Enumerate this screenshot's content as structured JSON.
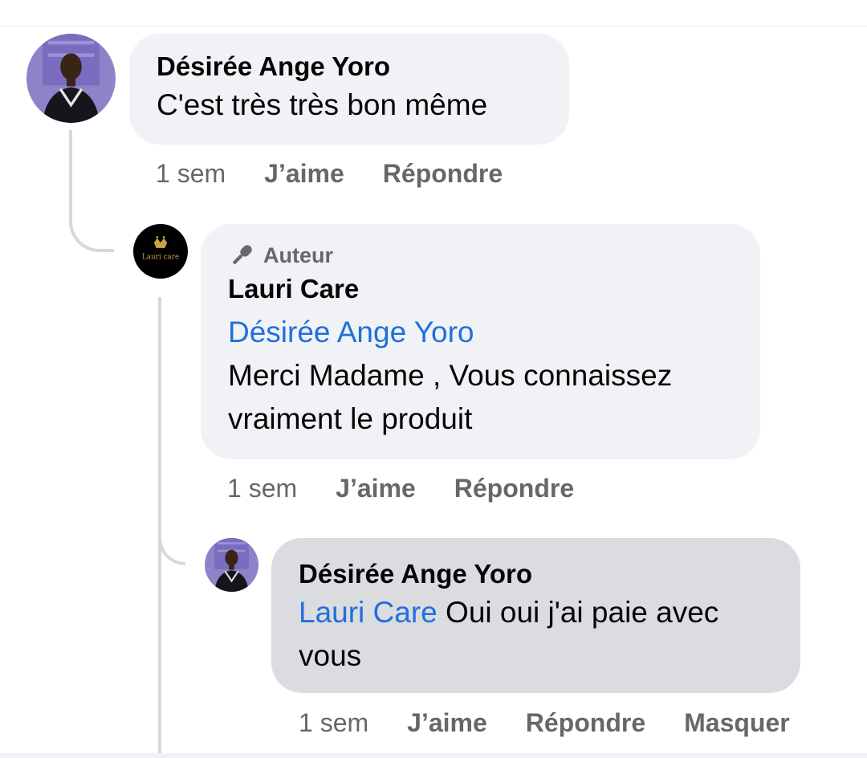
{
  "comments": [
    {
      "author": "Désirée Ange Yoro",
      "text": "C'est très très bon même",
      "time": "1 sem",
      "actions": [
        "J’aime",
        "Répondre"
      ]
    },
    {
      "badge": "Auteur",
      "badge_icon": "microphone-icon",
      "author": "Lauri Care",
      "mention": "Désirée Ange Yoro",
      "text": "Merci Madame , Vous connaissez vraiment le produit",
      "time": "1 sem",
      "actions": [
        "J’aime",
        "Répondre"
      ]
    },
    {
      "author": "Désirée Ange Yoro",
      "mention": "Lauri Care",
      "text": "Oui oui j'ai paie avec vous",
      "time": "1 sem",
      "actions": [
        "J’aime",
        "Répondre",
        "Masquer"
      ]
    }
  ],
  "brand_avatar_text": "Lauri care",
  "colors": {
    "mention": "#216fdb",
    "bubble": "#f0f2f5",
    "bubble_highlight": "#dadce0",
    "secondary_text": "#65676b"
  }
}
